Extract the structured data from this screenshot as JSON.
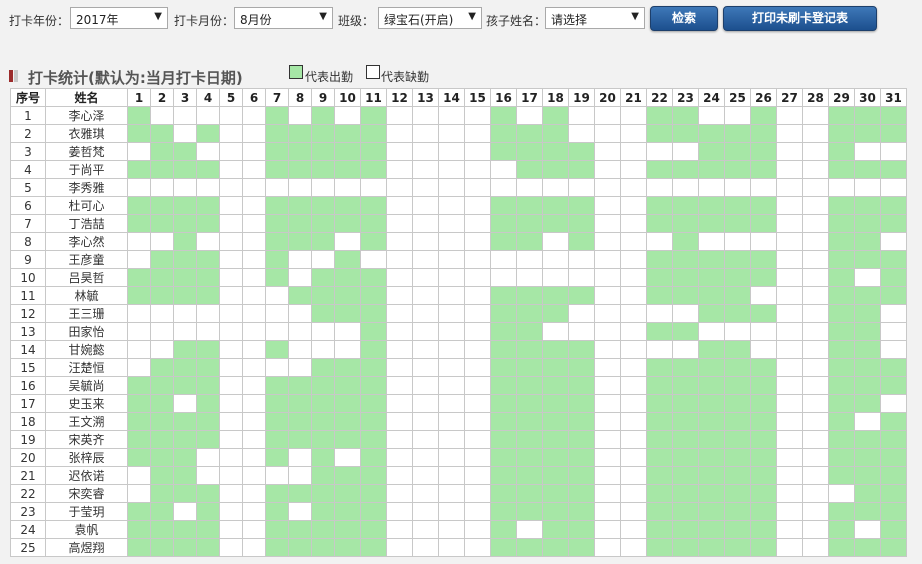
{
  "toolbar": {
    "year_label": "打卡年份：",
    "year_value": "2017年",
    "month_label": "打卡月份：",
    "month_value": "8月份",
    "class_label": "班级：",
    "class_value": "绿宝石(开启)",
    "child_label": "孩子姓名：",
    "child_value": "请选择",
    "search_button": "检索",
    "print_button": "打印未刷卡登记表"
  },
  "section": {
    "title": "打卡统计(默认为:当月打卡日期)",
    "legend_present": "代表出勤",
    "legend_absent": "代表缺勤"
  },
  "colors": {
    "present": "#a6e7a6",
    "absent": "#ffffff",
    "button": "#1c4f8e"
  },
  "table": {
    "headers": {
      "index": "序号",
      "name": "姓名"
    },
    "days": [
      "1",
      "2",
      "3",
      "4",
      "5",
      "6",
      "7",
      "8",
      "9",
      "10",
      "11",
      "12",
      "13",
      "14",
      "15",
      "16",
      "17",
      "18",
      "19",
      "20",
      "21",
      "22",
      "23",
      "24",
      "25",
      "26",
      "27",
      "28",
      "29",
      "30",
      "31"
    ],
    "rows": [
      {
        "index": "1",
        "name": "李心泽",
        "attendance": "1000001010100001010001100100111"
      },
      {
        "index": "2",
        "name": "衣雅琪",
        "attendance": "1101001111100001110001111100111"
      },
      {
        "index": "3",
        "name": "姜哲梵",
        "attendance": "0110001111100001111000011100100"
      },
      {
        "index": "4",
        "name": "于尚平",
        "attendance": "1111001111100000111001111100111"
      },
      {
        "index": "5",
        "name": "李秀雅",
        "attendance": "0000000000000000000000000000000"
      },
      {
        "index": "6",
        "name": "杜可心",
        "attendance": "1111001111100001111001111100111"
      },
      {
        "index": "7",
        "name": "丁浩喆",
        "attendance": "1111001111100001111001111100111"
      },
      {
        "index": "8",
        "name": "李心然",
        "attendance": "0010001110100001101000100000110"
      },
      {
        "index": "9",
        "name": "王彦童",
        "attendance": "0111001001000000000001111100111"
      },
      {
        "index": "10",
        "name": "吕昊哲",
        "attendance": "1111001011100000000001111100101"
      },
      {
        "index": "11",
        "name": "林毓",
        "attendance": "1111000111100001111001111000111"
      },
      {
        "index": "12",
        "name": "王三珊",
        "attendance": "0000000011100001110000011100110"
      },
      {
        "index": "13",
        "name": "田家怡",
        "attendance": "0000000000100001100001100000110"
      },
      {
        "index": "14",
        "name": "甘婉懿",
        "attendance": "0011001000100001111000011000110"
      },
      {
        "index": "15",
        "name": "汪楚恒",
        "attendance": "0111000011100001111001111100111"
      },
      {
        "index": "16",
        "name": "吴毓尚",
        "attendance": "1111001111100001111001111100111"
      },
      {
        "index": "17",
        "name": "史玉来",
        "attendance": "1101001111100001111001111100110"
      },
      {
        "index": "18",
        "name": "王文溯",
        "attendance": "1111001111100001111001111100101"
      },
      {
        "index": "19",
        "name": "宋英齐",
        "attendance": "1111001111100001111001111100111"
      },
      {
        "index": "20",
        "name": "张梓辰",
        "attendance": "1110001010100001111001111100111"
      },
      {
        "index": "21",
        "name": "迟依诺",
        "attendance": "0110000011100001111001111100111"
      },
      {
        "index": "22",
        "name": "宋奕睿",
        "attendance": "0111001111100001111001111100011"
      },
      {
        "index": "23",
        "name": "于莹玥",
        "attendance": "1101001011100001111001111100111"
      },
      {
        "index": "24",
        "name": "袁帆",
        "attendance": "1111001111100001011001111100101"
      },
      {
        "index": "25",
        "name": "高煜翔",
        "attendance": "1111001111100001111001111100111"
      }
    ]
  }
}
